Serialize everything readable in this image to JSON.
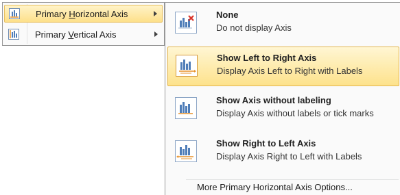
{
  "parent_menu": {
    "items": [
      {
        "label": "Primary Horizontal Axis",
        "icon": "horizontal-axis-chart-icon"
      },
      {
        "label": "Primary Vertical Axis",
        "icon": "vertical-axis-chart-icon"
      }
    ]
  },
  "submenu": {
    "options": [
      {
        "title": "None",
        "description": "Do not display Axis",
        "icon": "no-axis-icon"
      },
      {
        "title": "Show Left to Right Axis",
        "description": "Display Axis Left to Right with Labels",
        "icon": "left-to-right-axis-icon"
      },
      {
        "title": "Show Axis without labeling",
        "description": "Display Axis without labels or tick marks",
        "icon": "axis-without-labeling-icon"
      },
      {
        "title": "Show Right to Left Axis",
        "description": "Display Axis Right to Left with Labels",
        "icon": "right-to-left-axis-icon"
      }
    ],
    "more_options": "More Primary Horizontal Axis Options..."
  },
  "colors": {
    "highlight": "#fde28c",
    "icon_bars": "#4f7db8",
    "axis_orange": "#e8922a",
    "none_red": "#d9342b"
  }
}
